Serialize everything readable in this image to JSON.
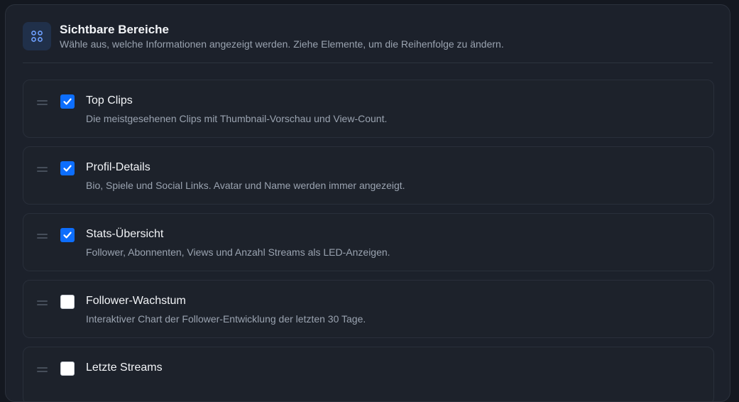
{
  "section": {
    "icon": "grid-icon",
    "title": "Sichtbare Bereiche",
    "description": "Wähle aus, welche Informationen angezeigt werden. Ziehe Elemente, um die Reihenfolge zu ändern."
  },
  "items": [
    {
      "title": "Top Clips",
      "description": "Die meistgesehenen Clips mit Thumbnail-Vorschau und View-Count.",
      "checked": true
    },
    {
      "title": "Profil-Details",
      "description": "Bio, Spiele und Social Links. Avatar und Name werden immer angezeigt.",
      "checked": true
    },
    {
      "title": "Stats-Übersicht",
      "description": "Follower, Abonnenten, Views und Anzahl Streams als LED-Anzeigen.",
      "checked": true
    },
    {
      "title": "Follower-Wachstum",
      "description": "Interaktiver Chart der Follower-Entwicklung der letzten 30 Tage.",
      "checked": false
    },
    {
      "title": "Letzte Streams",
      "description": "",
      "checked": false
    }
  ],
  "colors": {
    "accent": "#0d6efd",
    "background": "#1c212b"
  }
}
